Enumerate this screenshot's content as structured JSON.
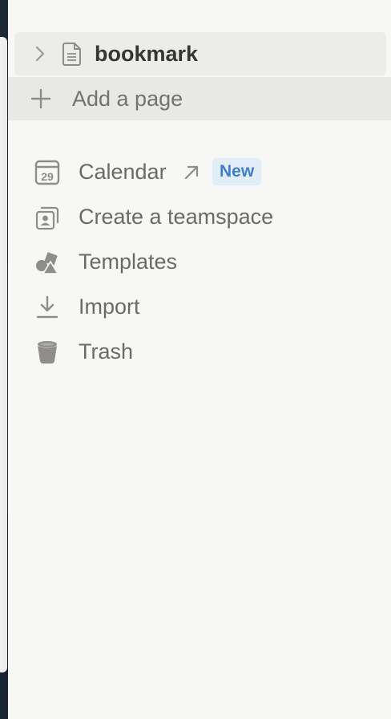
{
  "page": {
    "title": "bookmark"
  },
  "add_page": {
    "label": "Add a page"
  },
  "menu": {
    "calendar": {
      "label": "Calendar",
      "badge": "New",
      "date_icon_text": "29"
    },
    "teamspace": {
      "label": "Create a teamspace"
    },
    "templates": {
      "label": "Templates"
    },
    "import": {
      "label": "Import"
    },
    "trash": {
      "label": "Trash"
    }
  },
  "icons": {
    "chevron": "chevron-right-icon",
    "page": "document-icon",
    "add": "plus-icon",
    "calendar": "calendar-icon",
    "external": "arrow-up-right-icon",
    "teamspace": "teamspace-icon",
    "templates": "shapes-icon",
    "import": "download-icon",
    "trash": "trash-icon"
  },
  "colors": {
    "sidebar_bg": "#f7f7f5",
    "hover_bg": "#ececea",
    "text_primary": "#37352f",
    "text_secondary": "#6b6a66",
    "badge_bg": "#e3edf7",
    "badge_text": "#3e7fc8"
  }
}
